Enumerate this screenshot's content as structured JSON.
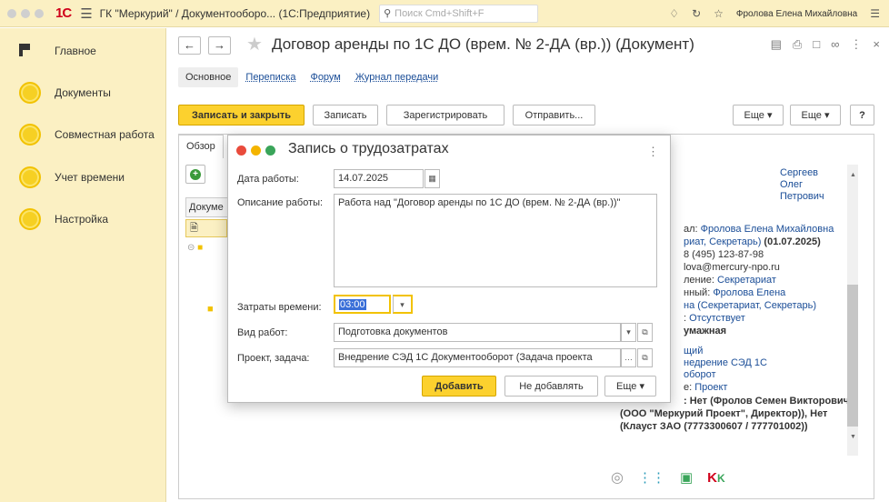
{
  "titlebar": {
    "logo": "1С",
    "title": "ГК \"Меркурий\" / Документооборо... (1С:Предприятие)",
    "search_placeholder": "Поиск Cmd+Shift+F",
    "user": "Фролова Елена Михайловна"
  },
  "sidebar": {
    "items": [
      {
        "label": "Главное",
        "icon": "flag-icon"
      },
      {
        "label": "Документы",
        "icon": "circle-icon"
      },
      {
        "label": "Совместная работа",
        "icon": "circle-icon"
      },
      {
        "label": "Учет времени",
        "icon": "circle-icon"
      },
      {
        "label": "Настройка",
        "icon": "circle-icon"
      }
    ]
  },
  "document": {
    "title": "Договор аренды по 1С ДО (врем. № 2-ДА (вр.)) (Документ)",
    "tabs": [
      "Основное",
      "Переписка",
      "Форум",
      "Журнал передачи"
    ],
    "buttons": {
      "save_close": "Записать и закрыть",
      "save": "Записать",
      "register": "Зарегистрировать",
      "send": "Отправить...",
      "more1": "Еще",
      "more2": "Еще",
      "help": "?"
    },
    "subtab": "Обзор",
    "list_header": "Докуме"
  },
  "right_panel": {
    "lines": [
      {
        "t": "Сергеев",
        "c": "blue"
      },
      {
        "t": "Олег",
        "c": "blue"
      },
      {
        "t": "Петрович",
        "c": "blue"
      },
      {
        "t": "ал: ",
        "t2": "Фролова Елена Михайловна",
        "c": "mix"
      },
      {
        "t": "риат, Секретарь)",
        "t2": " (01.07.2025)",
        "c": "mixb"
      },
      {
        "t": "8 (495) 123-87-98",
        "c": "plain"
      },
      {
        "t": "lova@mercury-npo.ru",
        "c": "plain"
      },
      {
        "t": "ление: ",
        "t2": "Секретариат",
        "c": "mix"
      },
      {
        "t": "нный: ",
        "t2": "Фролова Елена",
        "c": "mix"
      },
      {
        "t": "на (Секретариат, Секретарь)",
        "c": "blue"
      },
      {
        "t": ": ",
        "t2": "Отсутствует",
        "c": "mix"
      },
      {
        "t": "умажная",
        "c": "bold"
      },
      {
        "t": "щий",
        "c": "blue"
      },
      {
        "t": "недрение СЭД 1С",
        "c": "blue"
      },
      {
        "t": "оборот",
        "c": "blue"
      },
      {
        "t": "е: ",
        "t2": "Проект",
        "c": "mix"
      },
      {
        "t": ": Нет (Фролов Семен Викторович",
        "c": "bold"
      },
      {
        "t": "(ООО \"Меркурий Проект\", Директор)), Нет",
        "c": "bold"
      },
      {
        "t": "(Клауст ЗАО (7773300607 / 777701002))",
        "c": "bold"
      }
    ]
  },
  "dialog": {
    "title": "Запись о трудозатратах",
    "date_label": "Дата работы:",
    "date_value": "14.07.2025",
    "desc_label": "Описание работы:",
    "desc_value": "Работа над \"Договор аренды по 1С ДО (врем. № 2-ДА (вр.))\"",
    "time_label": "Затраты времени:",
    "time_value": "03:00",
    "kind_label": "Вид работ:",
    "kind_value": "Подготовка документов",
    "project_label": "Проект, задача:",
    "project_value": "Внедрение СЭД 1С Документооборот (Задача проекта",
    "add": "Добавить",
    "skip": "Не добавлять",
    "more": "Еще"
  },
  "colors": {
    "accent": "#fcd12e",
    "sidebar_bg": "#fbf0c3",
    "link": "#1a4d97"
  }
}
